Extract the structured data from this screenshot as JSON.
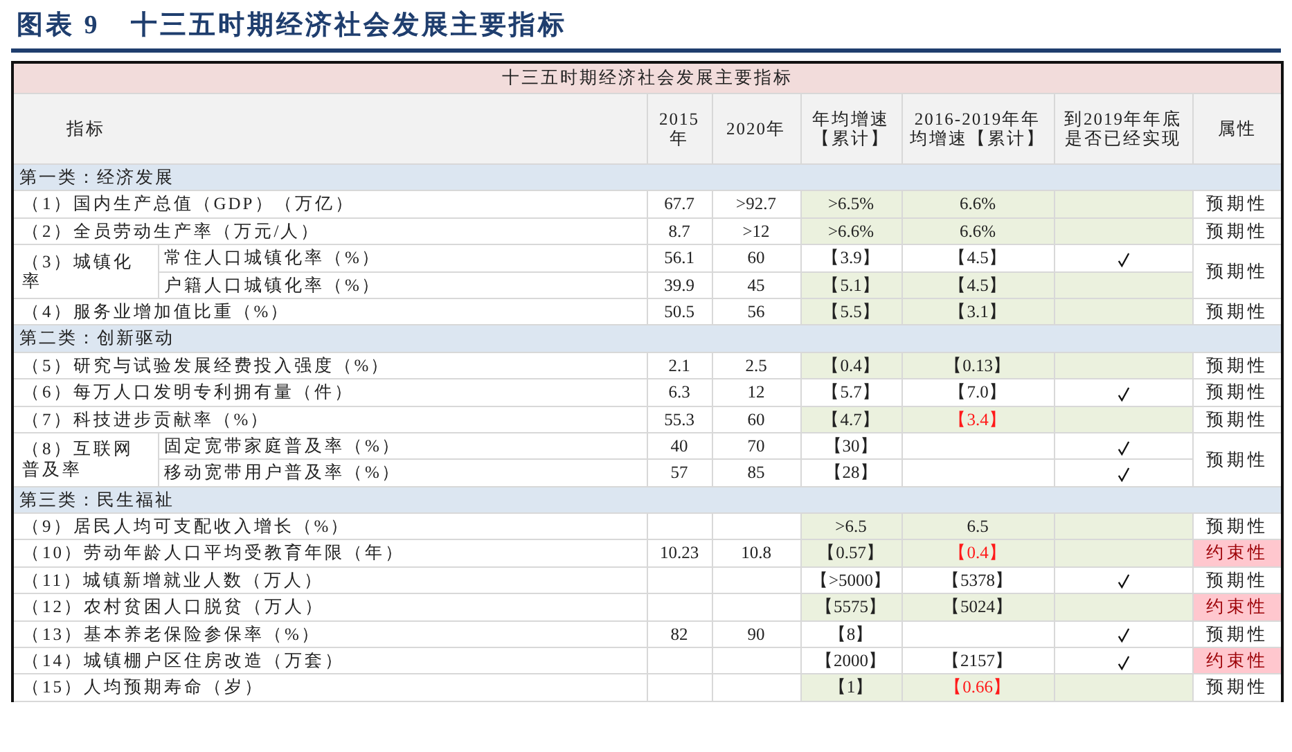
{
  "figure": {
    "label": "图表 9",
    "title": "十三五时期经济社会发展主要指标"
  },
  "table": {
    "title": "十三五时期经济社会发展主要指标",
    "columns": [
      "指标",
      "2015年",
      "2020年",
      "年均增速【累计】",
      "2016-2019年年均增速【累计】",
      "到2019年年底是否已经实现",
      "属性"
    ],
    "sections": [
      {
        "title": "第一类：经济发展",
        "rows": [
          {
            "label": "（1）国内生产总值（GDP）（万亿）",
            "y2015": "67.7",
            "y2020": ">92.7",
            "avg_growth": ">6.5%",
            "actual_growth": "6.6%",
            "below_target": false,
            "achieved": false,
            "attribute": "预期性",
            "binding": false
          },
          {
            "label": "（2）全员劳动生产率（万元/人）",
            "y2015": "8.7",
            "y2020": ">12",
            "avg_growth": ">6.6%",
            "actual_growth": "6.6%",
            "below_target": false,
            "achieved": false,
            "attribute": "预期性",
            "binding": false
          },
          {
            "label": "（3）城镇化率",
            "attribute": "预期性",
            "binding": false,
            "items": [
              {
                "label": "常住人口城镇化率（%）",
                "y2015": "56.1",
                "y2020": "60",
                "avg_growth": "【3.9】",
                "actual_growth": "【4.5】",
                "below_target": false,
                "achieved": true
              },
              {
                "label": "户籍人口城镇化率（%）",
                "y2015": "39.9",
                "y2020": "45",
                "avg_growth": "【5.1】",
                "actual_growth": "【4.5】",
                "below_target": false,
                "achieved": false
              }
            ]
          },
          {
            "label": "（4）服务业增加值比重（%）",
            "y2015": "50.5",
            "y2020": "56",
            "avg_growth": "【5.5】",
            "actual_growth": "【3.1】",
            "below_target": false,
            "achieved": false,
            "attribute": "预期性",
            "binding": false
          }
        ]
      },
      {
        "title": "第二类：创新驱动",
        "rows": [
          {
            "label": "（5）研究与试验发展经费投入强度（%）",
            "y2015": "2.1",
            "y2020": "2.5",
            "avg_growth": "【0.4】",
            "actual_growth": "【0.13】",
            "below_target": false,
            "achieved": false,
            "attribute": "预期性",
            "binding": false
          },
          {
            "label": "（6）每万人口发明专利拥有量（件）",
            "y2015": "6.3",
            "y2020": "12",
            "avg_growth": "【5.7】",
            "actual_growth": "【7.0】",
            "below_target": false,
            "achieved": true,
            "attribute": "预期性",
            "binding": false
          },
          {
            "label": "（7）科技进步贡献率（%）",
            "y2015": "55.3",
            "y2020": "60",
            "avg_growth": "【4.7】",
            "actual_growth": "【3.4】",
            "below_target": true,
            "achieved": false,
            "attribute": "预期性",
            "binding": false
          },
          {
            "label": "（8）互联网普及率",
            "attribute": "预期性",
            "binding": false,
            "items": [
              {
                "label": "固定宽带家庭普及率（%）",
                "y2015": "40",
                "y2020": "70",
                "avg_growth": "【30】",
                "achieved": true
              },
              {
                "label": "移动宽带用户普及率（%）",
                "y2015": "57",
                "y2020": "85",
                "avg_growth": "【28】",
                "achieved": true
              }
            ]
          }
        ]
      },
      {
        "title": "第三类：民生福祉",
        "rows": [
          {
            "label": "（9）居民人均可支配收入增长（%）",
            "avg_growth": ">6.5",
            "actual_growth": "6.5",
            "below_target": false,
            "achieved": false,
            "attribute": "预期性",
            "binding": false
          },
          {
            "label": "（10）劳动年龄人口平均受教育年限（年）",
            "y2015": "10.23",
            "y2020": "10.8",
            "avg_growth": "【0.57】",
            "actual_growth": "【0.4】",
            "below_target": true,
            "achieved": false,
            "attribute": "约束性",
            "binding": true
          },
          {
            "label": "（11）城镇新增就业人数（万人）",
            "avg_growth": "【>5000】",
            "actual_growth": "【5378】",
            "below_target": false,
            "achieved": true,
            "attribute": "预期性",
            "binding": false
          },
          {
            "label": "（12）农村贫困人口脱贫（万人）",
            "avg_growth": "【5575】",
            "actual_growth": "【5024】",
            "below_target": false,
            "achieved": false,
            "attribute": "约束性",
            "binding": true
          },
          {
            "label": "（13）基本养老保险参保率（%）",
            "y2015": "82",
            "y2020": "90",
            "avg_growth": "【8】",
            "achieved": true,
            "attribute": "预期性",
            "binding": false
          },
          {
            "label": "（14）城镇棚户区住房改造（万套）",
            "avg_growth": "【2000】",
            "actual_growth": "【2157】",
            "below_target": false,
            "achieved": true,
            "attribute": "约束性",
            "binding": true
          },
          {
            "label": "（15）人均预期寿命（岁）",
            "avg_growth": "【1】",
            "actual_growth": "【0.66】",
            "below_target": true,
            "achieved": false,
            "attribute": "预期性",
            "binding": false
          }
        ]
      }
    ]
  }
}
